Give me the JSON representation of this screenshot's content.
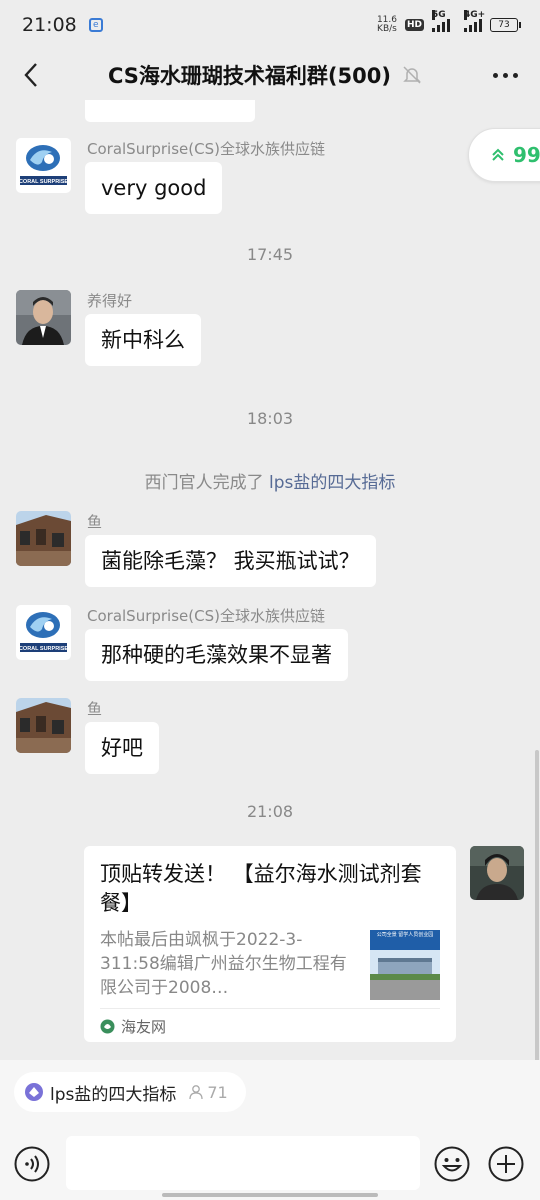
{
  "status_bar": {
    "time": "21:08",
    "net_speed_value": "11.6",
    "net_speed_unit": "KB/s",
    "hd": "HD",
    "sim1_network": "5G",
    "sim2_network": "4G+",
    "battery": "73"
  },
  "header": {
    "title": "CS海水珊瑚技术福利群(500)",
    "muted": true
  },
  "float_pill": {
    "text": "99"
  },
  "messages": [
    {
      "sender": "CoralSurprise(CS)全球水族供应链",
      "text": "very good"
    },
    {
      "sender": "养得好",
      "text": "新中科么"
    },
    {
      "sender": "鱼",
      "text": "菌能除毛藻？ 我买瓶试试？"
    },
    {
      "sender": "CoralSurprise(CS)全球水族供应链",
      "text": "那种硬的毛藻效果不显著"
    },
    {
      "sender": "鱼",
      "text": "好吧"
    }
  ],
  "timestamps": [
    "17:45",
    "18:03",
    "21:08"
  ],
  "system_message": {
    "prefix": "西门官人完成了",
    "link": "lps盐的四大指标"
  },
  "logo_text": "CORAL SURPRISE",
  "link_card": {
    "title": "顶贴转发送！ 【益尔海水测试剂套餐】",
    "description": "本帖最后由飒枫于2022-3-311:58编辑广州益尔生物工程有限公司于2008…",
    "thumbnail_caption": "公司全景 留学人员创业园",
    "source": "海友网"
  },
  "topic_bar": {
    "label": "lps盐的四大指标",
    "count": "71"
  },
  "colors": {
    "background": "#ededed",
    "link": "#576b95",
    "accent_green": "#2fbf6e"
  }
}
